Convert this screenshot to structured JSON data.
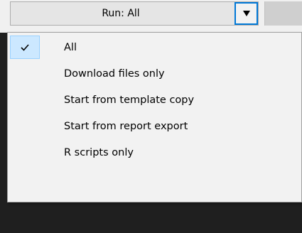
{
  "combo": {
    "label": "Run: All"
  },
  "menu": {
    "items": [
      {
        "label": "All",
        "checked": true
      },
      {
        "label": "Download files only",
        "checked": false
      },
      {
        "label": "Start from template copy",
        "checked": false
      },
      {
        "label": "Start from report export",
        "checked": false
      },
      {
        "label": "R scripts only",
        "checked": false
      }
    ]
  },
  "icons": {
    "dropdown": "triangle-down-icon",
    "check": "checkmark-icon"
  },
  "colors": {
    "focus_border": "#0078d7",
    "checked_bg": "#cce8ff",
    "backdrop": "#1f1f1f"
  }
}
